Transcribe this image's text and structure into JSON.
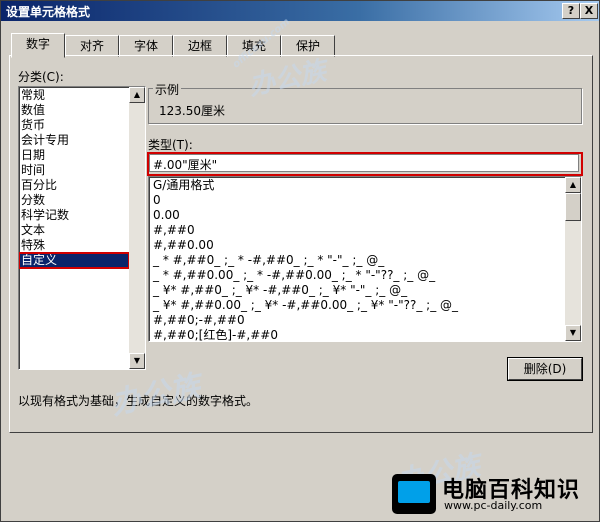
{
  "window": {
    "title": "设置单元格格式",
    "help_label": "?",
    "close_label": "X"
  },
  "tabs": [
    "数字",
    "对齐",
    "字体",
    "边框",
    "填充",
    "保护"
  ],
  "category": {
    "label": "分类(C):",
    "items": [
      "常规",
      "数值",
      "货币",
      "会计专用",
      "日期",
      "时间",
      "百分比",
      "分数",
      "科学记数",
      "文本",
      "特殊",
      "自定义"
    ],
    "selected": "自定义"
  },
  "sample": {
    "label": "示例",
    "value": "123.50厘米"
  },
  "type": {
    "label": "类型(T):",
    "input_value": "#.00\"厘米\""
  },
  "format_list": [
    "G/通用格式",
    "0",
    "0.00",
    "#,##0",
    "#,##0.00",
    "_ * #,##0_ ;_ * -#,##0_ ;_ * \"-\"_ ;_ @_",
    "_ * #,##0.00_ ;_ * -#,##0.00_ ;_ * \"-\"??_ ;_ @_",
    "_ ¥* #,##0_ ;_ ¥* -#,##0_ ;_ ¥* \"-\"_ ;_ @_",
    "_ ¥* #,##0.00_ ;_ ¥* -#,##0.00_ ;_ ¥* \"-\"??_ ;_ @_",
    "#,##0;-#,##0",
    "#,##0;[红色]-#,##0"
  ],
  "delete_label": "删除(D)",
  "description": "以现有格式为基础，生成自定义的数字格式。",
  "watermark": {
    "brand": "办公族",
    "url": "officezu.com"
  },
  "logo": {
    "name": "电脑百科知识",
    "url": "www.pc-daily.com"
  },
  "colors": {
    "selection": "#0a246a",
    "highlight_border": "#d10000",
    "face": "#d4d0c8"
  }
}
